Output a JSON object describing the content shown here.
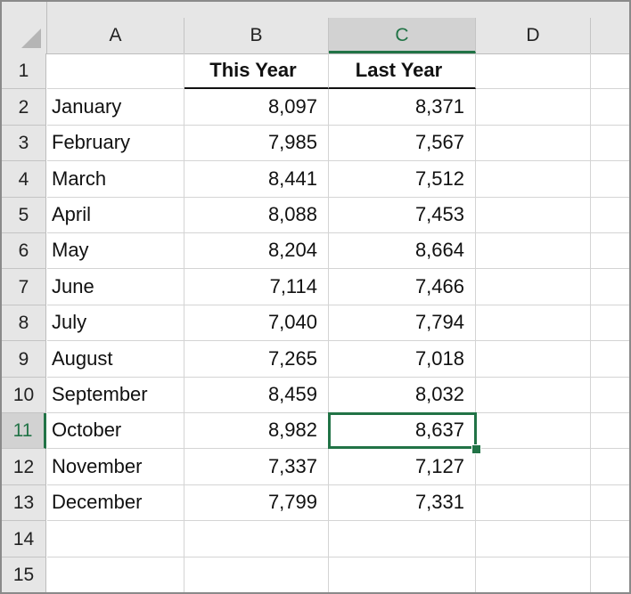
{
  "columns": [
    "A",
    "B",
    "C",
    "D",
    ""
  ],
  "selected_cell": "C11",
  "accent_color": "#217346",
  "headers": {
    "b": "This Year",
    "c": "Last Year"
  },
  "rows": [
    {
      "n": "1",
      "a": "",
      "b": "",
      "c": ""
    },
    {
      "n": "2",
      "a": "January",
      "b": "8,097",
      "c": "8,371"
    },
    {
      "n": "3",
      "a": "February",
      "b": "7,985",
      "c": "7,567"
    },
    {
      "n": "4",
      "a": "March",
      "b": "8,441",
      "c": "7,512"
    },
    {
      "n": "5",
      "a": "April",
      "b": "8,088",
      "c": "7,453"
    },
    {
      "n": "6",
      "a": "May",
      "b": "8,204",
      "c": "8,664"
    },
    {
      "n": "7",
      "a": "June",
      "b": "7,114",
      "c": "7,466"
    },
    {
      "n": "8",
      "a": "July",
      "b": "7,040",
      "c": "7,794"
    },
    {
      "n": "9",
      "a": "August",
      "b": "7,265",
      "c": "7,018"
    },
    {
      "n": "10",
      "a": "September",
      "b": "8,459",
      "c": "8,032"
    },
    {
      "n": "11",
      "a": "October",
      "b": "8,982",
      "c": "8,637"
    },
    {
      "n": "12",
      "a": "November",
      "b": "7,337",
      "c": "7,127"
    },
    {
      "n": "13",
      "a": "December",
      "b": "7,799",
      "c": "7,331"
    },
    {
      "n": "14",
      "a": "",
      "b": "",
      "c": ""
    },
    {
      "n": "15",
      "a": "",
      "b": "",
      "c": ""
    }
  ]
}
